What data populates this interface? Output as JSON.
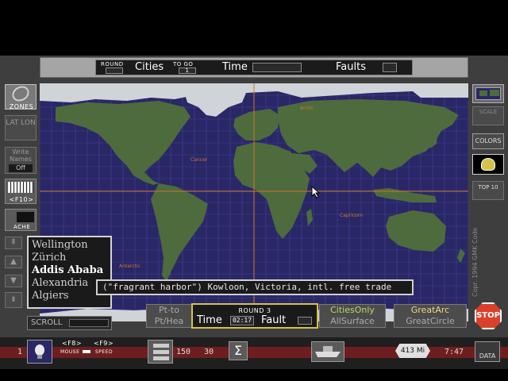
{
  "status": {
    "round_label": "ROUND",
    "cities_label": "Cities",
    "to_go_label": "TO GO",
    "to_go_value": "1",
    "time_label": "Time",
    "faults_label": "Faults"
  },
  "map": {
    "labels": {
      "arctic": "Arctic",
      "cancer": "Cancer",
      "capricorn": "Capricorn",
      "antarctic": "Antarctic"
    }
  },
  "left_panel": {
    "zones_label": "ZONES",
    "lat_lon_label": "LAT LON",
    "write_names_label": "Write Names",
    "write_names_value": "Off",
    "f10_label": "<F10>",
    "ache_label": "ACHE"
  },
  "right_panel": {
    "scale_label": "SCALE",
    "colors_label": "COLORS",
    "top10_label": "TOP 10",
    "copyright": "Copr. 1994 GMK Code"
  },
  "city_list": {
    "items": [
      "Wellington",
      "Zürich",
      "Addis Ababa",
      "Alexandria",
      "Algiers"
    ],
    "selected_index": 2
  },
  "tooltip": {
    "text": "(\"fragrant harbor\") Kowloon, Victoria, intl. free trade"
  },
  "scroll_label": "SCROLL",
  "round_box": {
    "title": "ROUND 3",
    "time_label": "Time",
    "time_value": "02:17",
    "fault_label": "Fault"
  },
  "mode_buttons": {
    "pt_top": "Pt-to",
    "pt_bottom": "Pt/Hea",
    "cities_only": "CitiesOnly",
    "all_surface": "AllSurface",
    "great_arc": "GreatArc",
    "great_circle": "GreatCircle",
    "stop": "STOP"
  },
  "footer": {
    "f8": "<F8>",
    "f9": "<F9>",
    "mouse": "MOUSE",
    "speed": "SPEED",
    "num1": "150",
    "num2": "30",
    "sigma": "Σ",
    "distance": "413 Mi",
    "time": "7:47",
    "data_label": "DATA",
    "left_num": "1"
  },
  "colors": {
    "ocean": "#2a2766",
    "land": "#4e6b3d",
    "ice": "#d0d3d8",
    "tropic_line": "#d2742a",
    "fault_yellow": "#d4c24a",
    "stop_red": "#d9402c"
  }
}
